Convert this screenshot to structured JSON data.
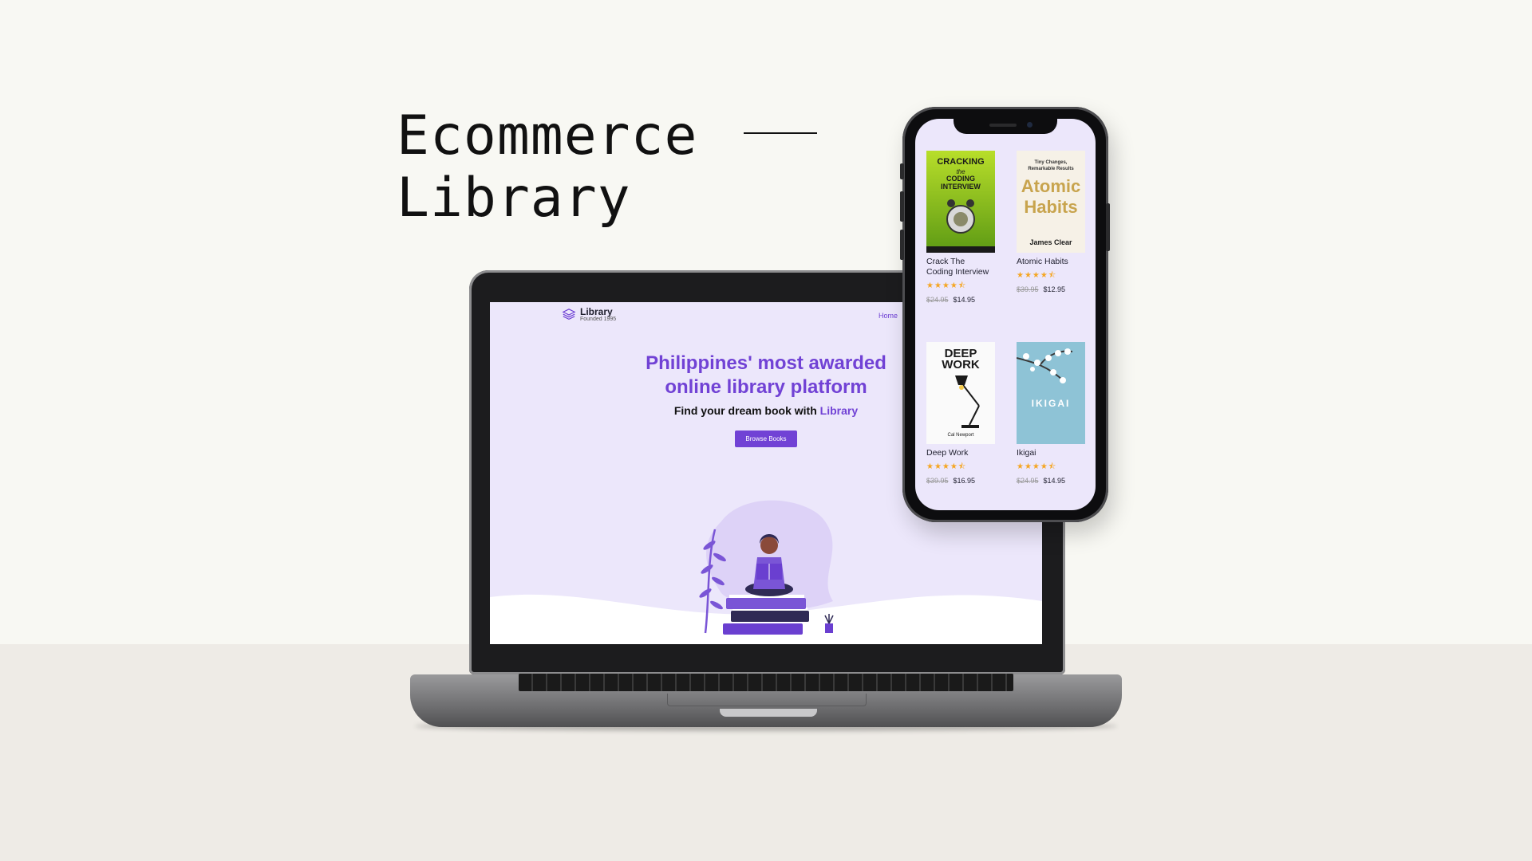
{
  "headline": {
    "line1": "Ecommerce",
    "line2": "Library"
  },
  "site": {
    "logo_name": "Library",
    "logo_sub": "Founded 1995",
    "nav_home": "Home",
    "hero_title_line1": "Philippines' most awarded",
    "hero_title_line2": "online library platform",
    "hero_sub_prefix": "Find your dream book with ",
    "hero_sub_accent": "Library",
    "cta_label": "Browse Books"
  },
  "colors": {
    "accent": "#7142d5",
    "page_bg": "#f8f8f3",
    "screen_bg": "#ece7fb",
    "star": "#f5a623"
  },
  "books": [
    {
      "title": "Crack The Coding Interview",
      "stars": "★★★★⯪",
      "old_price": "$24.95",
      "new_price": "$14.95",
      "cover_line1": "CRACKING",
      "cover_line2": "the",
      "cover_line3": "CODING INTERVIEW"
    },
    {
      "title": "Atomic Habits",
      "stars": "★★★★⯪",
      "old_price": "$39.95",
      "new_price": "$12.95",
      "cover_line1": "Tiny Changes,",
      "cover_line2": "Remarkable Results",
      "cover_line3": "Atomic",
      "cover_line4": "Habits",
      "cover_line5": "James Clear"
    },
    {
      "title": "Deep Work",
      "stars": "★★★★⯪",
      "old_price": "$39.95",
      "new_price": "$16.95",
      "cover_line1": "DEEP",
      "cover_line2": "WORK",
      "cover_line3": "Cal Newport"
    },
    {
      "title": "Ikigai",
      "stars": "★★★★⯪",
      "old_price": "$24.95",
      "new_price": "$14.95",
      "cover_line1": "IKIGAI"
    }
  ]
}
